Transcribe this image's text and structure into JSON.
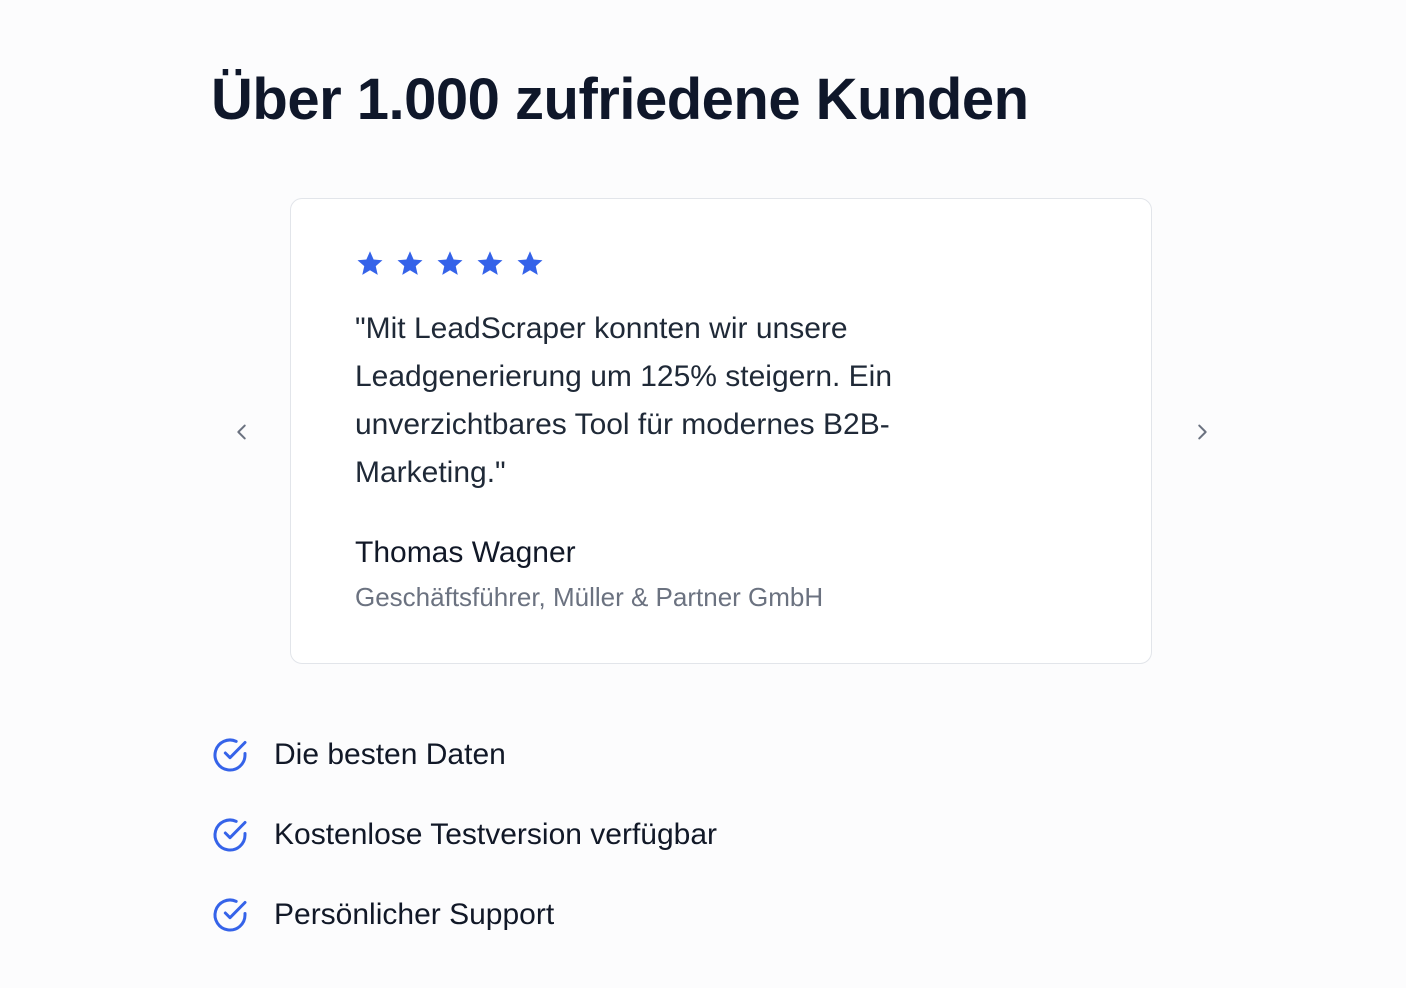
{
  "section": {
    "title": "Über 1.000 zufriedene Kunden"
  },
  "testimonial": {
    "rating": 5,
    "rating_max": 5,
    "star_color": "#3563e9",
    "quote": "\"Mit LeadScraper konnten wir unsere Leadgenerierung um 125% steigern. Ein unverzichtbares Tool für modernes B2B-Marketing.\"",
    "author_name": "Thomas Wagner",
    "author_role": "Geschäftsführer, Müller & Partner GmbH"
  },
  "carousel": {
    "prev_icon": "chevron-left-icon",
    "next_icon": "chevron-right-icon"
  },
  "features": [
    {
      "icon": "check-circle-icon",
      "label": "Die besten Daten"
    },
    {
      "icon": "check-circle-icon",
      "label": "Kostenlose Testversion verfügbar"
    },
    {
      "icon": "check-circle-icon",
      "label": "Persönlicher Support"
    }
  ],
  "colors": {
    "accent": "#3563e9",
    "heading": "#0f172a",
    "muted_text": "#6b7280",
    "card_border": "#e2e5ea"
  }
}
